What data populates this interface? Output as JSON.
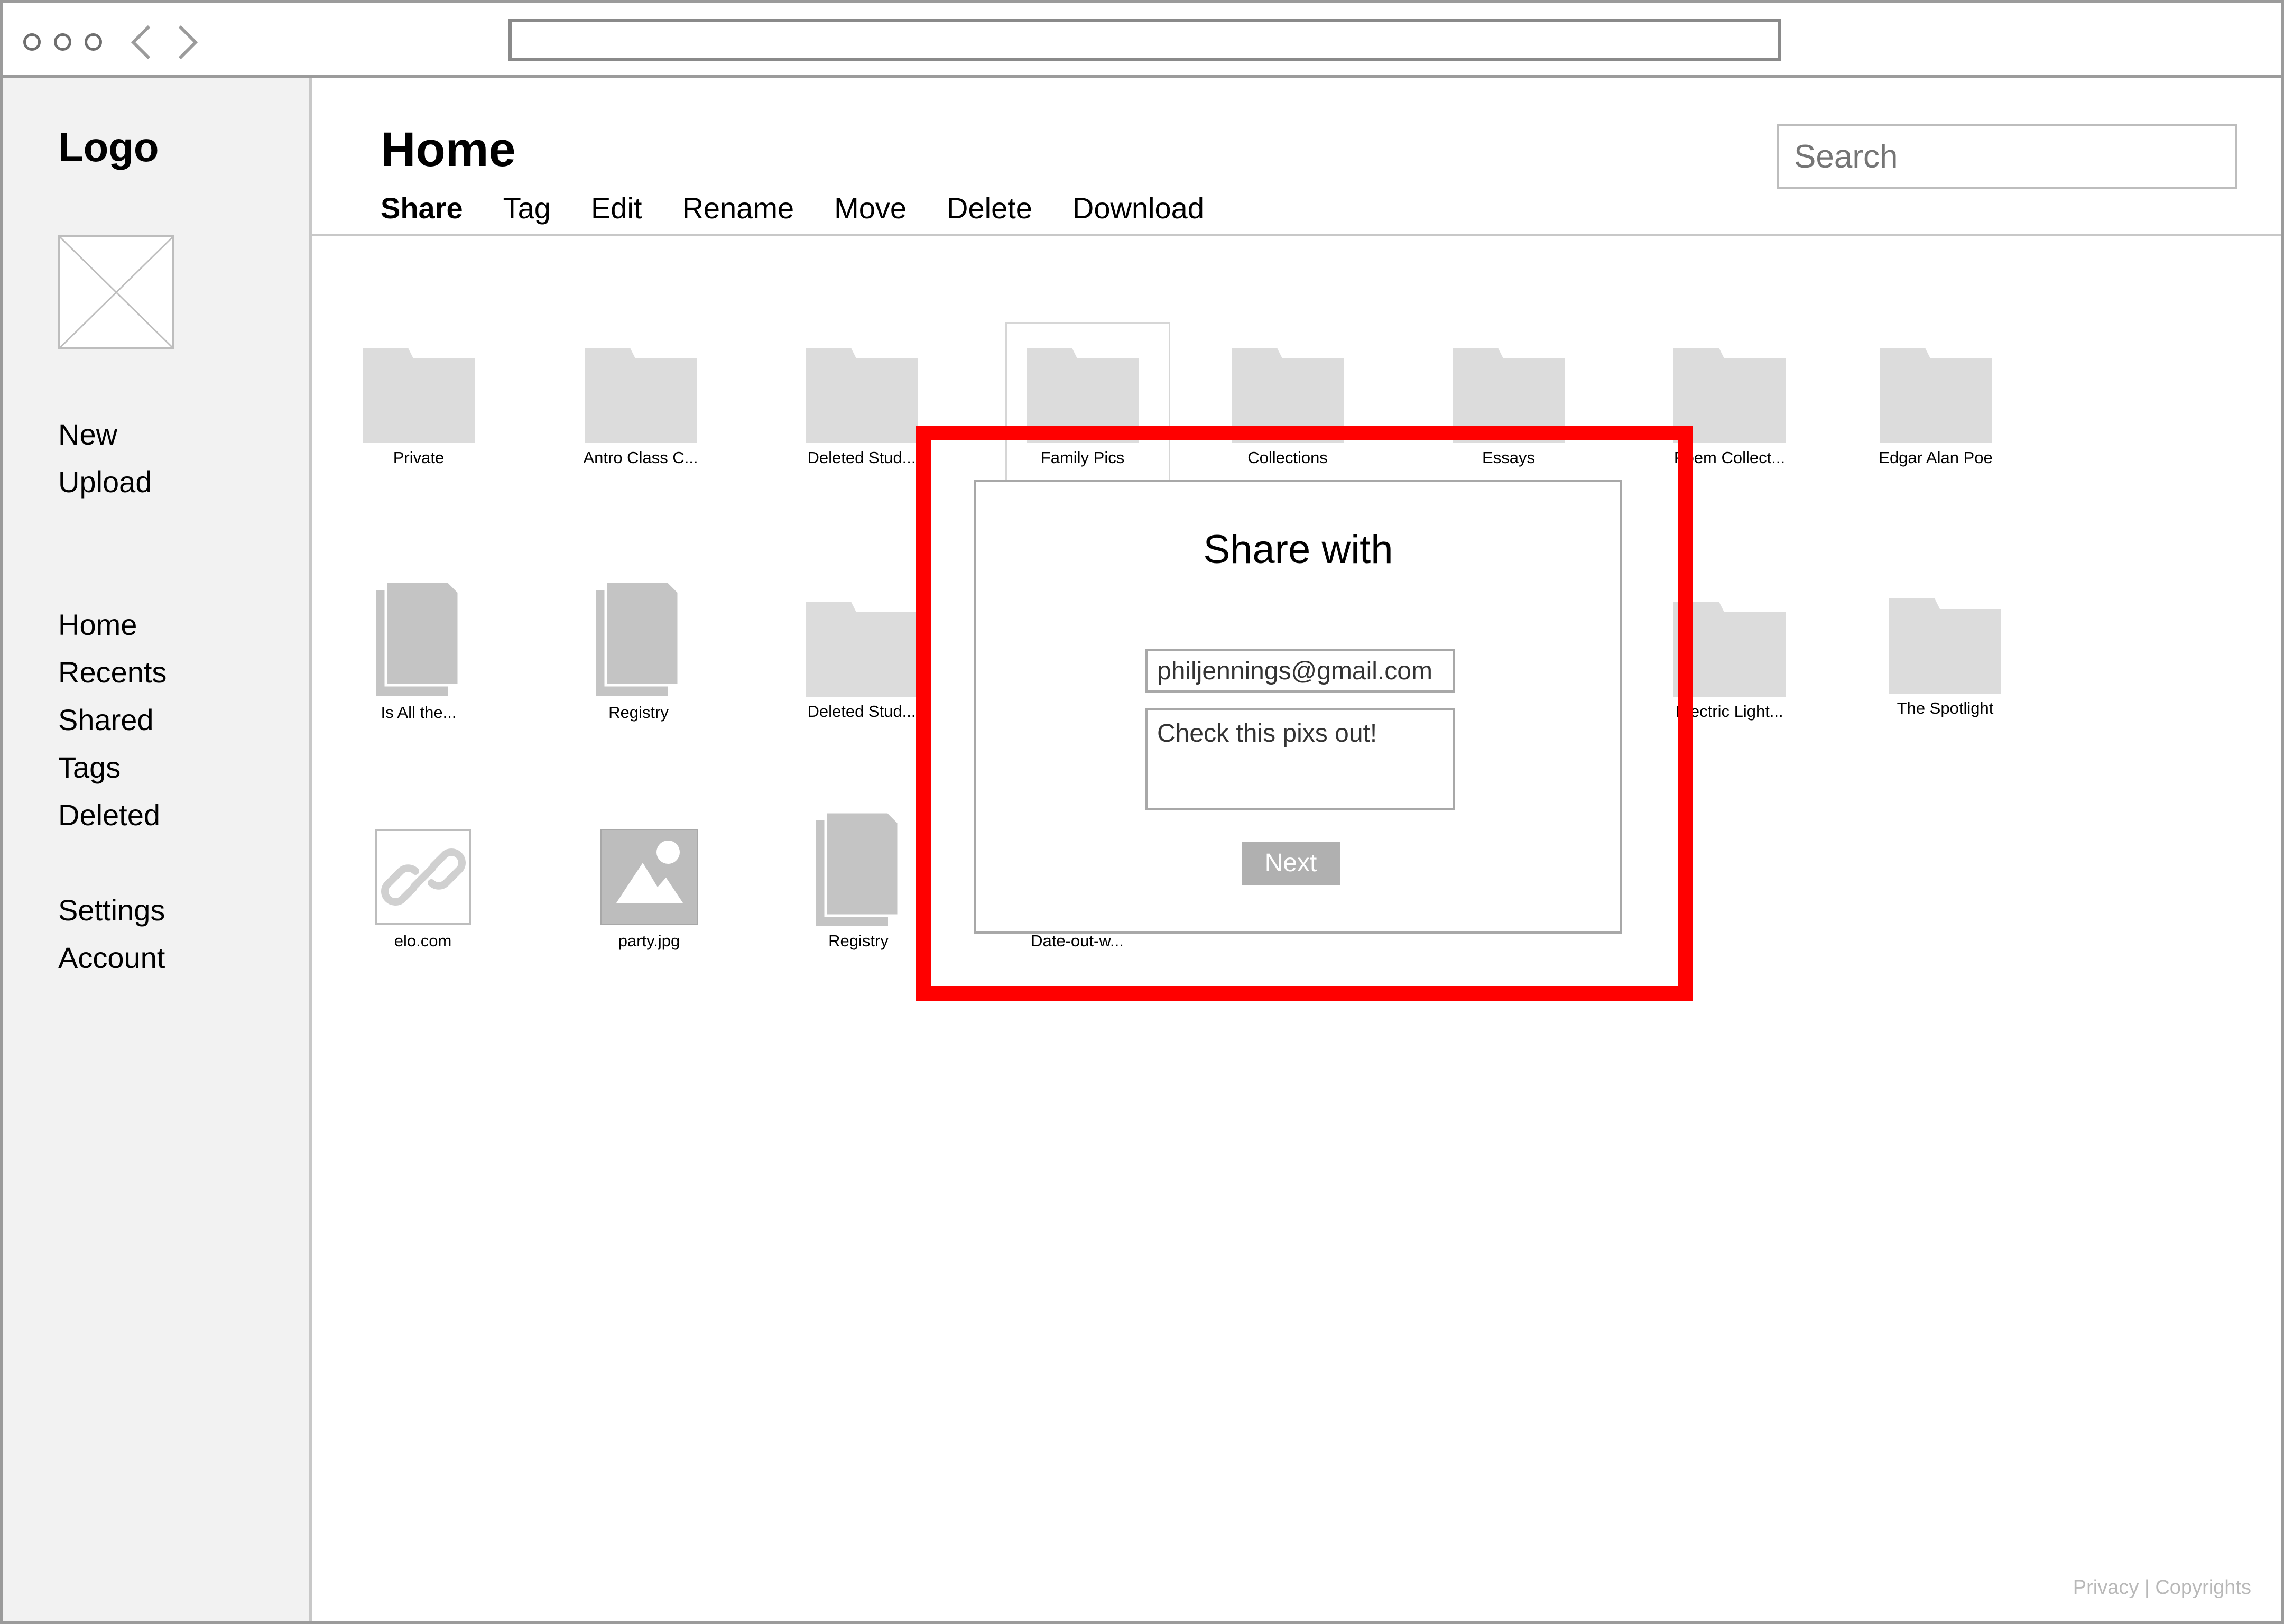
{
  "sidebar": {
    "logo": "Logo",
    "actions": [
      "New",
      "Upload"
    ],
    "nav": [
      "Home",
      "Recents",
      "Shared",
      "Tags",
      "Deleted"
    ],
    "account": [
      "Settings",
      "Account"
    ]
  },
  "header": {
    "title": "Home",
    "search_placeholder": "Search",
    "toolbar": [
      "Share",
      "Tag",
      "Edit",
      "Rename",
      "Move",
      "Delete",
      "Download"
    ]
  },
  "files": {
    "row1": [
      "Private",
      "Antro Class C...",
      "Deleted Stud...",
      "Family Pics",
      "Collections",
      "Essays",
      "Poem Collect...",
      "Edgar Alan Poe"
    ],
    "row2": [
      "Is All the...",
      "Registry",
      "Deleted Stud...",
      "Electric Light...",
      "The Spotlight"
    ],
    "row3": [
      "elo.com",
      "party.jpg",
      "Registry",
      "Date-out-w..."
    ]
  },
  "modal": {
    "title": "Share with",
    "email_value": "philjennings@gmail.com",
    "message_value": "Check this pixs out!",
    "next_label": "Next"
  },
  "footer": {
    "text": "Privacy | Copyrights"
  },
  "colors": {
    "callout": "#ff0000",
    "folder": "#dcdcdc",
    "document": "#c4c4c4",
    "sidebar_bg": "#f2f2f2"
  }
}
